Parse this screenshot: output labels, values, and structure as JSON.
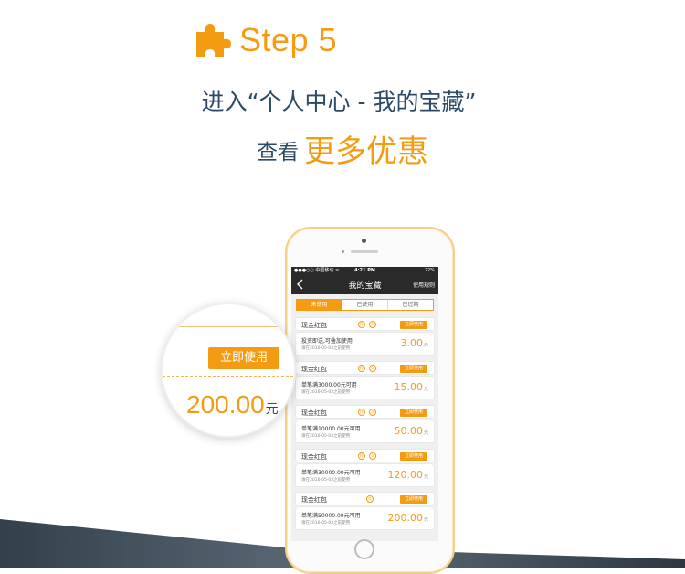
{
  "header": {
    "step_label": "Step 5",
    "line1": "进入“个人中心 - 我的宝藏”",
    "line2_prefix": "查看",
    "line2_highlight": "更多优惠"
  },
  "colors": {
    "accent": "#f39c12",
    "heading": "#2c4a68",
    "phone_bar": "#2a2a2a"
  },
  "phone": {
    "status": {
      "carrier": "●●●○○ 中国移动 ᯤ",
      "time": "4:21 PM",
      "battery": "22%"
    },
    "nav": {
      "title": "我的宝藏",
      "right": "使用规则"
    },
    "tabs": [
      "未使用",
      "已使用",
      "已过期"
    ],
    "coupons": [
      {
        "title": "现金红包",
        "badges": [
          "投",
          "久"
        ],
        "button": "立即使用",
        "condition": "投资即送,可叠加使用",
        "date": "请在2016-05-03之前使用",
        "amount": "3.00",
        "unit": "元"
      },
      {
        "title": "现金红包",
        "badges": [
          "投",
          "久"
        ],
        "button": "立即使用",
        "condition": "单笔满3000.00元可用",
        "date": "请在2016-05-03之前使用",
        "amount": "15.00",
        "unit": "元"
      },
      {
        "title": "现金红包",
        "badges": [
          "投",
          "久"
        ],
        "button": "立即使用",
        "condition": "单笔满10000.00元可用",
        "date": "请在2016-05-03之前使用",
        "amount": "50.00",
        "unit": "元"
      },
      {
        "title": "现金红包",
        "badges": [
          "投",
          "久"
        ],
        "button": "立即使用",
        "condition": "单笔满30000.00元可用",
        "date": "请在2016-05-03之前使用",
        "amount": "120.00",
        "unit": "元"
      },
      {
        "title": "现金红包",
        "badges": [
          "久"
        ],
        "button": "立即使用",
        "condition": "单笔满50000.00元可用",
        "date": "请在2016-05-03之前使用",
        "amount": "200.00",
        "unit": "元"
      }
    ]
  },
  "magnifier": {
    "button": "立即使用",
    "amount": "200.00",
    "unit": "元"
  }
}
